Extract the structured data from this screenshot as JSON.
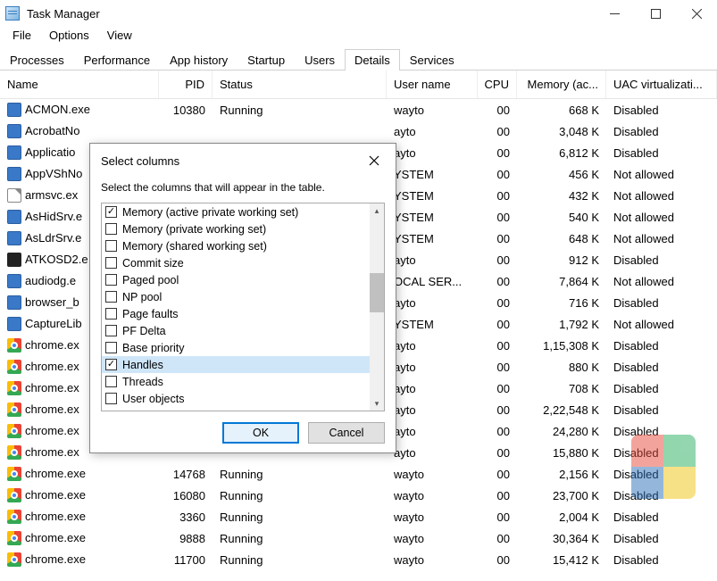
{
  "window": {
    "title": "Task Manager"
  },
  "menu": {
    "items": [
      "File",
      "Options",
      "View"
    ]
  },
  "tabs": {
    "items": [
      "Processes",
      "Performance",
      "App history",
      "Startup",
      "Users",
      "Details",
      "Services"
    ],
    "active": 5
  },
  "columns": {
    "name": "Name",
    "pid": "PID",
    "status": "Status",
    "user": "User name",
    "cpu": "CPU",
    "mem": "Memory (ac...",
    "uac": "UAC virtualizati..."
  },
  "rows": [
    {
      "icon": "generic",
      "name": "ACMON.exe",
      "pid": "10380",
      "status": "Running",
      "user": "wayto",
      "cpu": "00",
      "mem": "668 K",
      "uac": "Disabled"
    },
    {
      "icon": "generic",
      "name": "AcrobatNo",
      "pid": "",
      "status": "",
      "user": "ayto",
      "cpu": "00",
      "mem": "3,048 K",
      "uac": "Disabled"
    },
    {
      "icon": "generic",
      "name": "Applicatio",
      "pid": "",
      "status": "",
      "user": "ayto",
      "cpu": "00",
      "mem": "6,812 K",
      "uac": "Disabled"
    },
    {
      "icon": "generic",
      "name": "AppVShNo",
      "pid": "",
      "status": "",
      "user": "YSTEM",
      "cpu": "00",
      "mem": "456 K",
      "uac": "Not allowed"
    },
    {
      "icon": "doc",
      "name": "armsvc.ex",
      "pid": "",
      "status": "",
      "user": "YSTEM",
      "cpu": "00",
      "mem": "432 K",
      "uac": "Not allowed"
    },
    {
      "icon": "generic",
      "name": "AsHidSrv.e",
      "pid": "",
      "status": "",
      "user": "YSTEM",
      "cpu": "00",
      "mem": "540 K",
      "uac": "Not allowed"
    },
    {
      "icon": "generic",
      "name": "AsLdrSrv.e",
      "pid": "",
      "status": "",
      "user": "YSTEM",
      "cpu": "00",
      "mem": "648 K",
      "uac": "Not allowed"
    },
    {
      "icon": "at",
      "name": "ATKOSD2.e",
      "pid": "",
      "status": "",
      "user": "ayto",
      "cpu": "00",
      "mem": "912 K",
      "uac": "Disabled"
    },
    {
      "icon": "generic",
      "name": "audiodg.e",
      "pid": "",
      "status": "",
      "user": "OCAL SER...",
      "cpu": "00",
      "mem": "7,864 K",
      "uac": "Not allowed"
    },
    {
      "icon": "generic",
      "name": "browser_b",
      "pid": "",
      "status": "",
      "user": "ayto",
      "cpu": "00",
      "mem": "716 K",
      "uac": "Disabled"
    },
    {
      "icon": "generic",
      "name": "CaptureLib",
      "pid": "",
      "status": "",
      "user": "YSTEM",
      "cpu": "00",
      "mem": "1,792 K",
      "uac": "Not allowed"
    },
    {
      "icon": "chrome",
      "name": "chrome.ex",
      "pid": "",
      "status": "",
      "user": "ayto",
      "cpu": "00",
      "mem": "1,15,308 K",
      "uac": "Disabled"
    },
    {
      "icon": "chrome",
      "name": "chrome.ex",
      "pid": "",
      "status": "",
      "user": "ayto",
      "cpu": "00",
      "mem": "880 K",
      "uac": "Disabled"
    },
    {
      "icon": "chrome",
      "name": "chrome.ex",
      "pid": "",
      "status": "",
      "user": "ayto",
      "cpu": "00",
      "mem": "708 K",
      "uac": "Disabled"
    },
    {
      "icon": "chrome",
      "name": "chrome.ex",
      "pid": "",
      "status": "",
      "user": "ayto",
      "cpu": "00",
      "mem": "2,22,548 K",
      "uac": "Disabled"
    },
    {
      "icon": "chrome",
      "name": "chrome.ex",
      "pid": "",
      "status": "",
      "user": "ayto",
      "cpu": "00",
      "mem": "24,280 K",
      "uac": "Disabled"
    },
    {
      "icon": "chrome",
      "name": "chrome.ex",
      "pid": "",
      "status": "",
      "user": "ayto",
      "cpu": "00",
      "mem": "15,880 K",
      "uac": "Disabled"
    },
    {
      "icon": "chrome",
      "name": "chrome.exe",
      "pid": "14768",
      "status": "Running",
      "user": "wayto",
      "cpu": "00",
      "mem": "2,156 K",
      "uac": "Disabled"
    },
    {
      "icon": "chrome",
      "name": "chrome.exe",
      "pid": "16080",
      "status": "Running",
      "user": "wayto",
      "cpu": "00",
      "mem": "23,700 K",
      "uac": "Disabled"
    },
    {
      "icon": "chrome",
      "name": "chrome.exe",
      "pid": "3360",
      "status": "Running",
      "user": "wayto",
      "cpu": "00",
      "mem": "2,004 K",
      "uac": "Disabled"
    },
    {
      "icon": "chrome",
      "name": "chrome.exe",
      "pid": "9888",
      "status": "Running",
      "user": "wayto",
      "cpu": "00",
      "mem": "30,364 K",
      "uac": "Disabled"
    },
    {
      "icon": "chrome",
      "name": "chrome.exe",
      "pid": "11700",
      "status": "Running",
      "user": "wayto",
      "cpu": "00",
      "mem": "15,412 K",
      "uac": "Disabled"
    }
  ],
  "dialog": {
    "title": "Select columns",
    "message": "Select the columns that will appear in the table.",
    "items": [
      {
        "label": "Memory (active private working set)",
        "checked": true
      },
      {
        "label": "Memory (private working set)",
        "checked": false
      },
      {
        "label": "Memory (shared working set)",
        "checked": false
      },
      {
        "label": "Commit size",
        "checked": false
      },
      {
        "label": "Paged pool",
        "checked": false
      },
      {
        "label": "NP pool",
        "checked": false
      },
      {
        "label": "Page faults",
        "checked": false
      },
      {
        "label": "PF Delta",
        "checked": false
      },
      {
        "label": "Base priority",
        "checked": false
      },
      {
        "label": "Handles",
        "checked": true,
        "selected": true
      },
      {
        "label": "Threads",
        "checked": false
      },
      {
        "label": "User objects",
        "checked": false
      }
    ],
    "ok": "OK",
    "cancel": "Cancel"
  }
}
